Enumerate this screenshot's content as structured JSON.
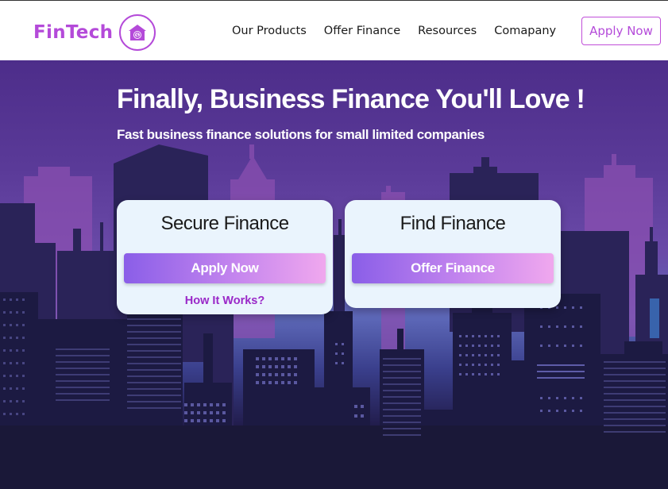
{
  "brand": {
    "name": "FinTech",
    "color": "#b44ad9",
    "icon": "house-money-icon"
  },
  "nav": {
    "items": [
      {
        "label": "Our Products"
      },
      {
        "label": "Offer Finance"
      },
      {
        "label": "Resources"
      },
      {
        "label": "Comapany"
      }
    ],
    "apply_label": "Apply Now"
  },
  "hero": {
    "title": "Finally, Business Finance You'll Love !",
    "subtitle": "Fast business finance solutions for small limited companies"
  },
  "cards": [
    {
      "title": "Secure Finance",
      "button_label": "Apply Now",
      "link_label": "How It Works?"
    },
    {
      "title": "Find Finance",
      "button_label": "Offer Finance"
    }
  ],
  "colors": {
    "accent": "#b44ad9",
    "button_gradient_start": "#8a5ee8",
    "button_gradient_end": "#f0a8ee",
    "card_background": "#eaf4fd",
    "link": "#9a28c8"
  }
}
